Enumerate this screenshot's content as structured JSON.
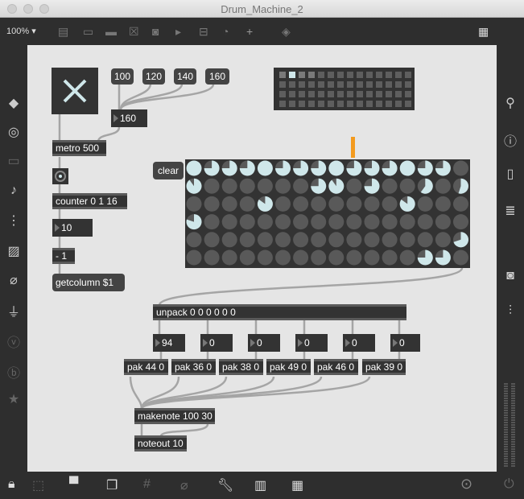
{
  "window": {
    "title": "Drum_Machine_2"
  },
  "toolbar": {
    "zoom": "100%"
  },
  "patch": {
    "messages": [
      "100",
      "120",
      "140",
      "160"
    ],
    "tempo_number": "160",
    "metro": "metro 500",
    "counter": "counter 0 1 16",
    "counter_number": "10",
    "minus": "- 1",
    "getcolumn": "getcolumn $1",
    "clear": "clear",
    "unpack": "unpack 0 0 0 0 0 0",
    "velocity_numbers": [
      "94",
      "0",
      "0",
      "0",
      "0",
      "0"
    ],
    "paks": [
      "pak 44 0",
      "pak 36 0",
      "pak 38 0",
      "pak 49 0",
      "pak 46 0",
      "pak 39 0"
    ],
    "makenote": "makenote 100 30",
    "noteout": "noteout 10"
  },
  "dial_grid": [
    [
      1,
      0.75,
      0.75,
      0.75,
      1,
      0.75,
      0.75,
      0.75,
      1,
      0.75,
      0.75,
      0.75,
      1,
      0.75,
      0.75,
      0
    ],
    [
      0.9,
      0,
      0,
      0,
      0,
      0,
      0,
      0.75,
      0.9,
      0,
      0.75,
      0,
      0,
      0.6,
      0,
      0.55
    ],
    [
      0,
      0,
      0,
      0,
      0.85,
      0,
      0,
      0,
      0,
      0,
      0,
      0,
      0.85,
      0,
      0,
      0
    ],
    [
      0.8,
      0,
      0,
      0,
      0,
      0,
      0,
      0,
      0,
      0,
      0,
      0,
      0,
      0,
      0,
      0
    ],
    [
      0,
      0,
      0,
      0,
      0,
      0,
      0,
      0,
      0,
      0,
      0,
      0,
      0,
      0,
      0,
      0.7
    ],
    [
      0,
      0,
      0,
      0,
      0,
      0,
      0,
      0,
      0,
      0,
      0,
      0,
      0,
      0.75,
      0.75,
      0
    ]
  ],
  "matrix": {
    "rows": 4,
    "cols": 14,
    "active_cell": [
      0,
      1
    ],
    "dim_cells": [
      [
        0,
        0
      ],
      [
        0,
        2
      ],
      [
        0,
        3
      ]
    ]
  },
  "colors": {
    "dial_on": "#cfe7ea",
    "dial_off": "#595959",
    "accent": "#f39a1e"
  }
}
